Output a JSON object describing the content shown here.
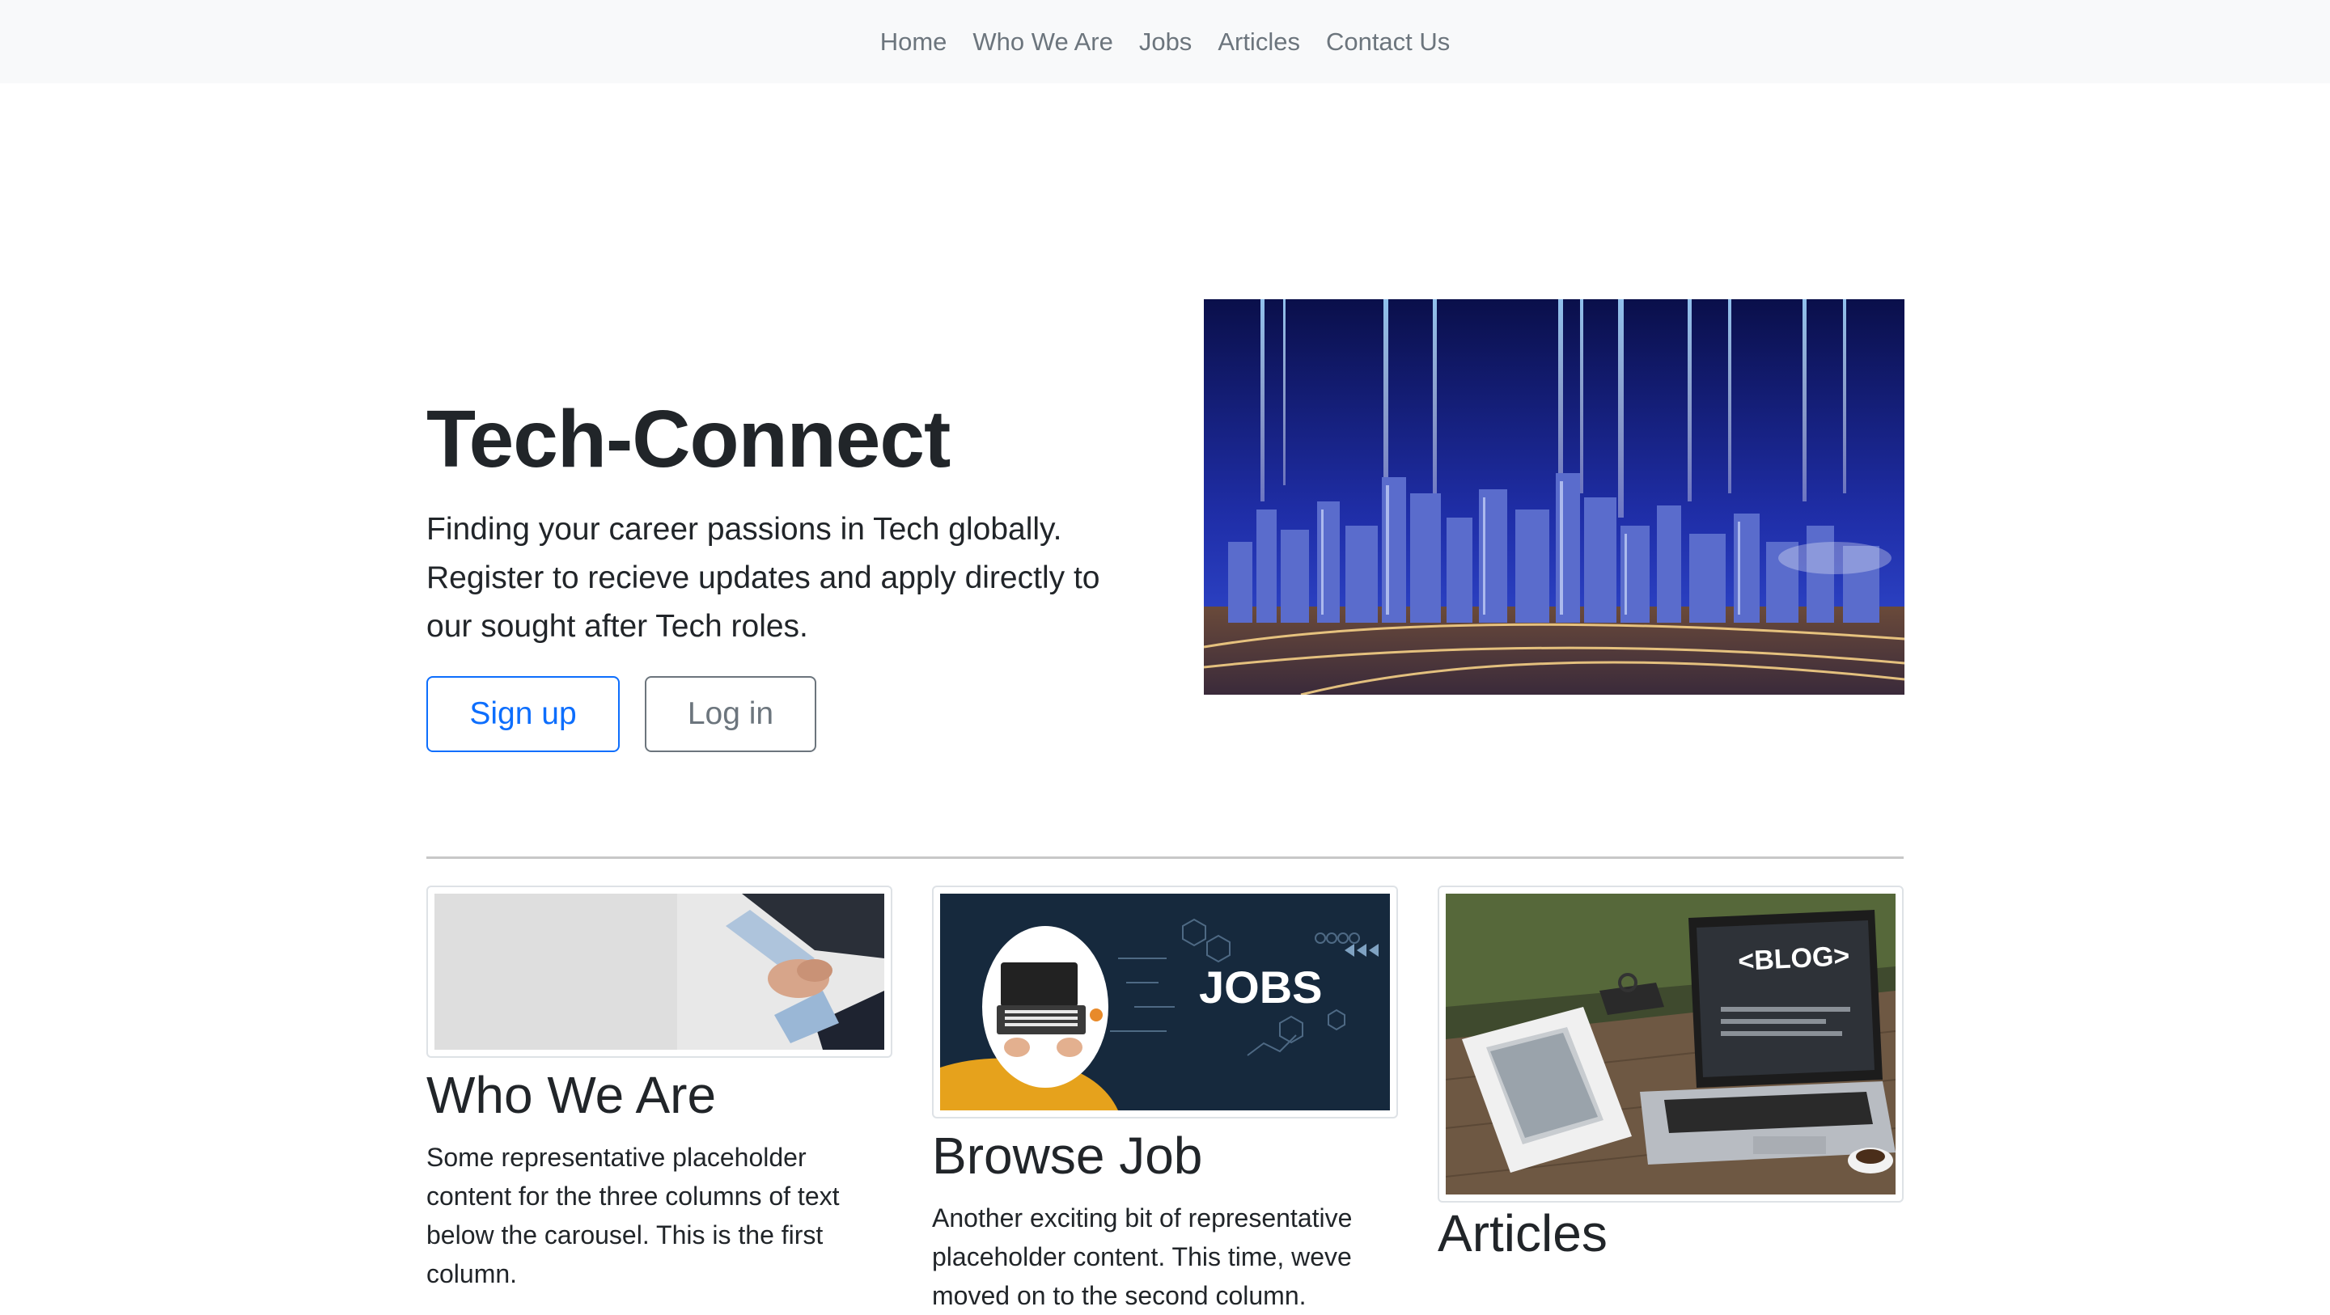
{
  "nav": {
    "items": [
      {
        "label": "Home",
        "name": "nav-home"
      },
      {
        "label": "Who We Are",
        "name": "nav-who-we-are"
      },
      {
        "label": "Jobs",
        "name": "nav-jobs"
      },
      {
        "label": "Articles",
        "name": "nav-articles"
      },
      {
        "label": "Contact Us",
        "name": "nav-contact-us"
      }
    ]
  },
  "hero": {
    "title": "Tech-Connect",
    "lead": "Finding your career passions in Tech globally. Register to recieve updates and apply directly to our sought after Tech roles.",
    "signup_label": "Sign up",
    "login_label": "Log in"
  },
  "cards": [
    {
      "title": "Who We Are",
      "text": "Some representative placeholder content for the three columns of text below the carousel. This is the first column."
    },
    {
      "title": "Browse Job",
      "text": "Another exciting bit of representative placeholder content. This time, weve moved on to the second column."
    },
    {
      "title": "Articles",
      "text": ""
    }
  ],
  "images": {
    "jobs_text": "JOBS",
    "blog_text": "<BLOG>"
  },
  "colors": {
    "primary": "#0d6efd",
    "secondary": "#6c757d",
    "navbar_bg": "#f8f9fa",
    "text": "#212529"
  }
}
